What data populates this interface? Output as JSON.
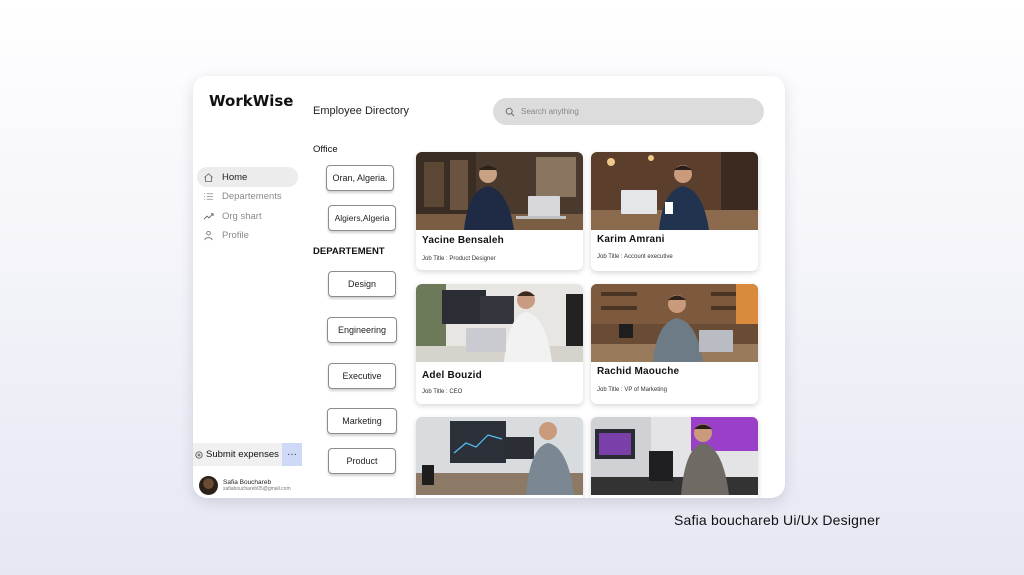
{
  "app": {
    "brand": "WorkWise",
    "page_title": "Employee Directory"
  },
  "search": {
    "placeholder": "Search anything"
  },
  "sidebar": {
    "items": [
      {
        "label": "Home",
        "icon": "home-icon",
        "active": true
      },
      {
        "label": "Departements",
        "icon": "list-icon",
        "active": false
      },
      {
        "label": "Org shart",
        "icon": "trending-icon",
        "active": false
      },
      {
        "label": "Profile",
        "icon": "user-icon",
        "active": false
      }
    ],
    "submit_label": "Submit expenses",
    "more_label": "···",
    "user": {
      "name": "Safia Bouchareb",
      "email": "safiabouchareb05@gmail.com"
    }
  },
  "filters": {
    "office_title": "Office",
    "offices": [
      "Oran, Algeria.",
      "Algiers,Algeria"
    ],
    "department_title": "DEPARTEMENT",
    "departments": [
      "Design",
      "Engineering",
      "Executive",
      "Marketing",
      "Product"
    ]
  },
  "employees": [
    {
      "name": "Yacine Bensaleh",
      "title": "Job Title : Product Designer"
    },
    {
      "name": "Karim Amrani",
      "title": "Job Title : Account executive"
    },
    {
      "name": "Adel Bouzid",
      "title": "Job Title : CEO"
    },
    {
      "name": "Rachid Maouche",
      "title": "Job Title : VP of Marketing"
    },
    {
      "name": "",
      "title": ""
    },
    {
      "name": "",
      "title": ""
    }
  ],
  "credit": "Safia bouchareb Ui/Ux Designer",
  "colors": {
    "accent_more": "#cdd9f6",
    "search_bg": "#dcdcdc",
    "active_nav": "#ececec"
  }
}
